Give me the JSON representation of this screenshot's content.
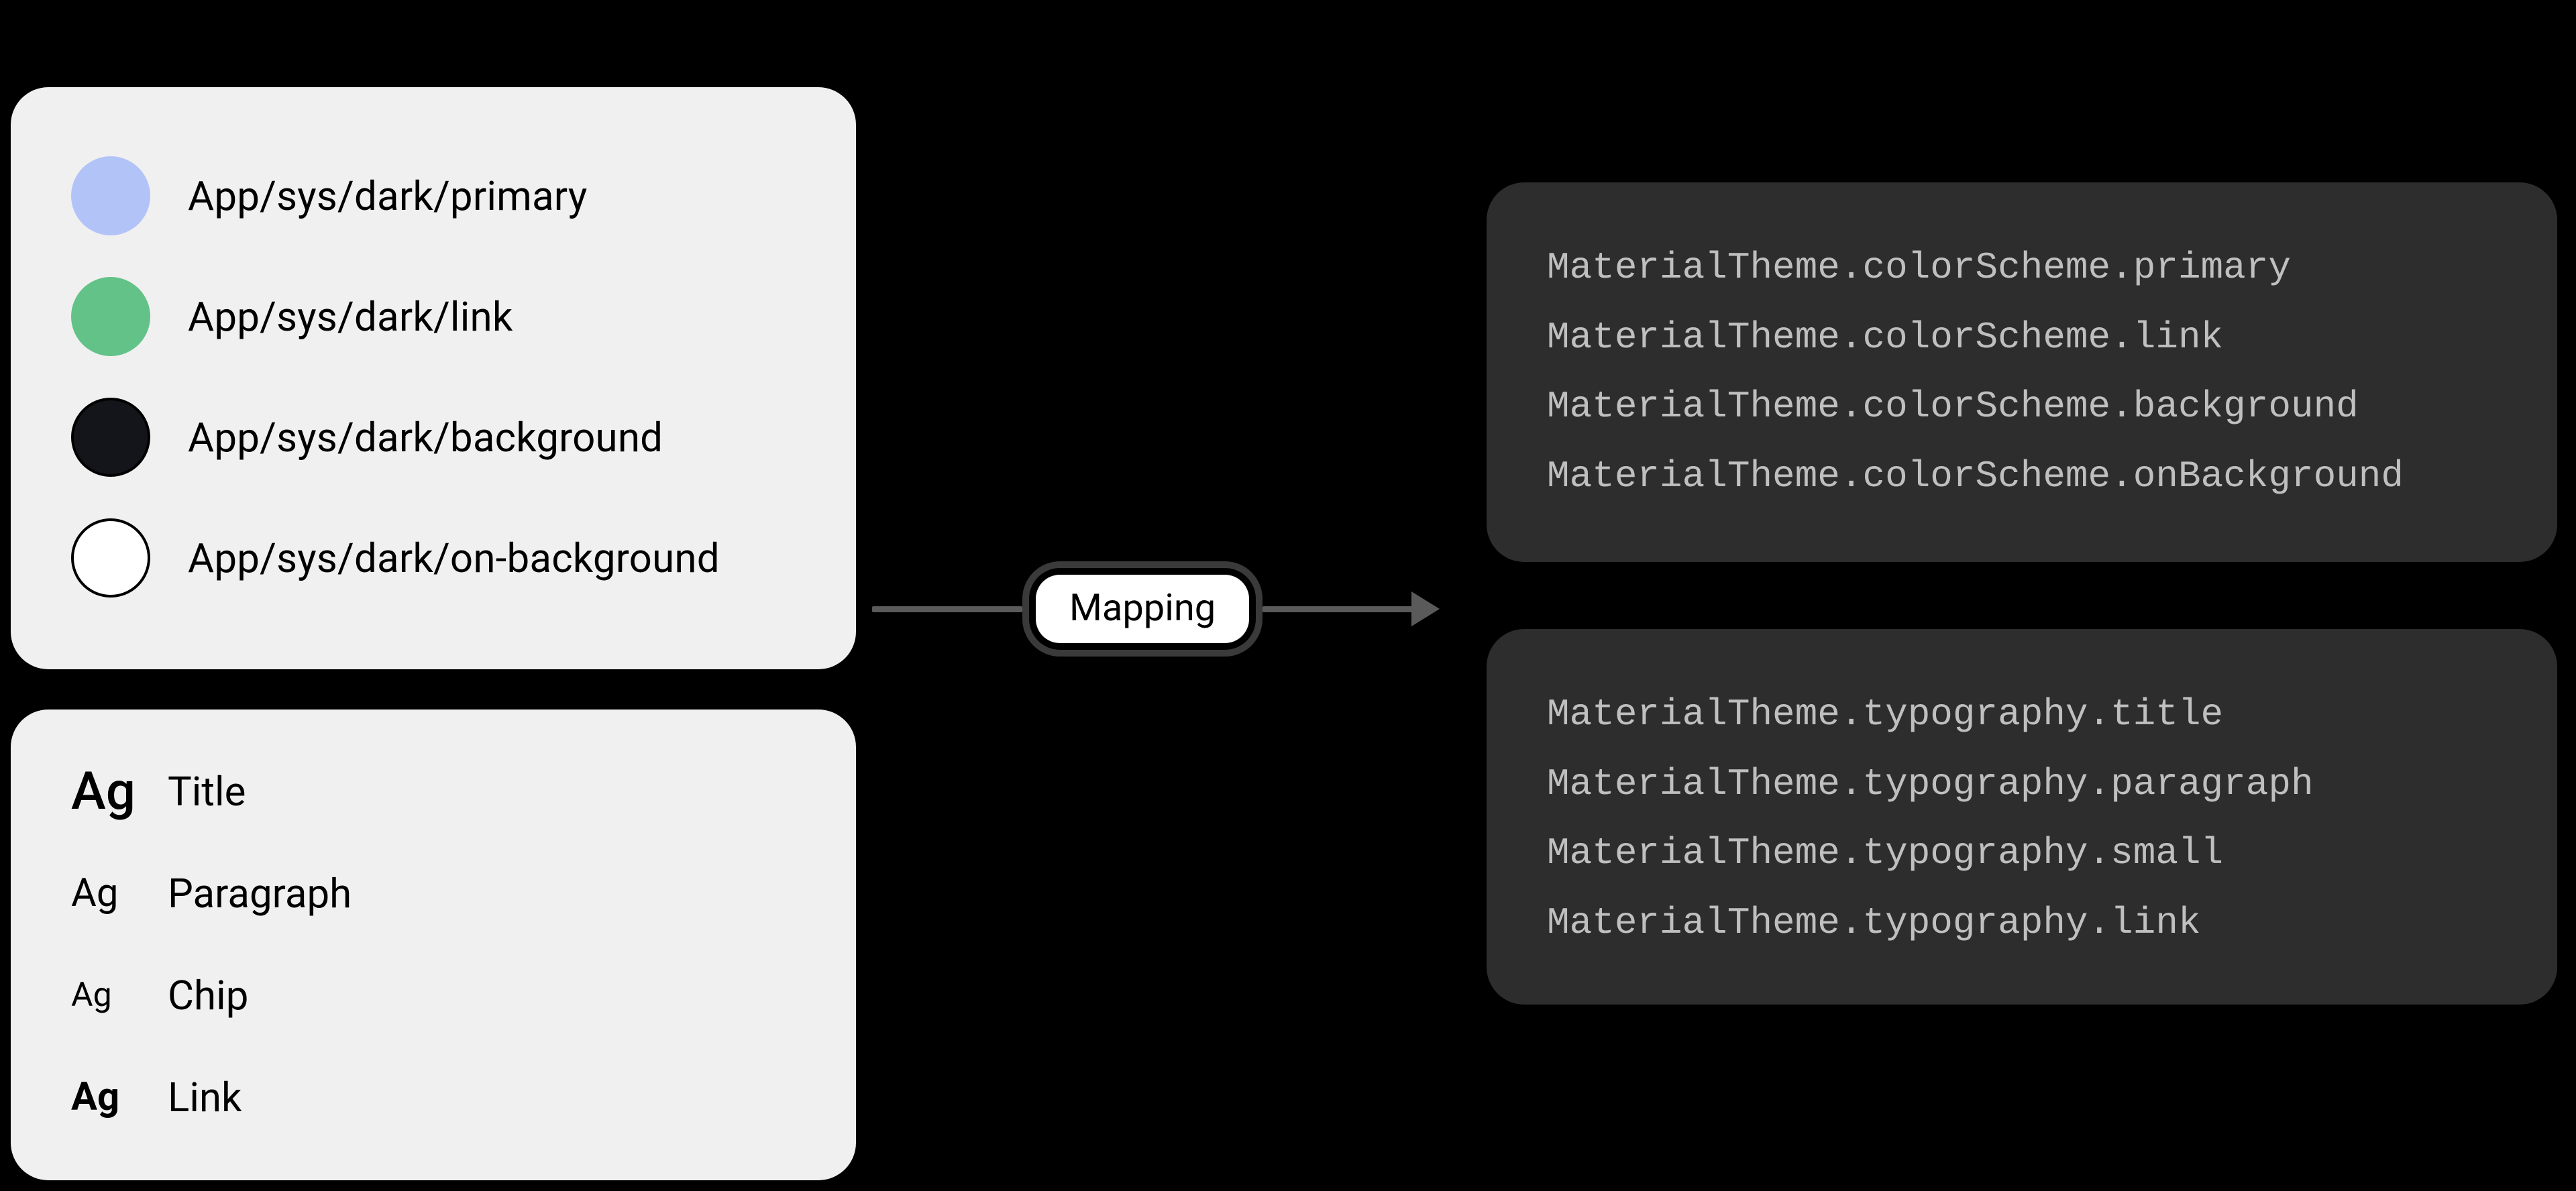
{
  "design_tokens": {
    "colors": [
      {
        "label": "App/sys/dark/primary",
        "hex": "#B2C4F7",
        "bordered": false
      },
      {
        "label": "App/sys/dark/link",
        "hex": "#62C288",
        "bordered": false
      },
      {
        "label": "App/sys/dark/background",
        "hex": "#14151A",
        "bordered": true
      },
      {
        "label": "App/sys/dark/on-background",
        "hex": "#FFFFFF",
        "bordered": true
      }
    ],
    "typography": [
      {
        "glyph": "Ag",
        "style_key": "title",
        "label": "Title"
      },
      {
        "glyph": "Ag",
        "style_key": "paragraph",
        "label": "Paragraph"
      },
      {
        "glyph": "Ag",
        "style_key": "chip",
        "label": "Chip"
      },
      {
        "glyph": "Ag",
        "style_key": "link",
        "label": "Link"
      }
    ]
  },
  "connector": {
    "label": "Mapping"
  },
  "code_output": {
    "color_scheme_lines": [
      "MaterialTheme.colorScheme.primary",
      "MaterialTheme.colorScheme.link",
      "MaterialTheme.colorScheme.background",
      "MaterialTheme.colorScheme.onBackground"
    ],
    "typography_lines": [
      "MaterialTheme.typography.title",
      "MaterialTheme.typography.paragraph",
      "MaterialTheme.typography.small",
      "MaterialTheme.typography.link"
    ]
  }
}
